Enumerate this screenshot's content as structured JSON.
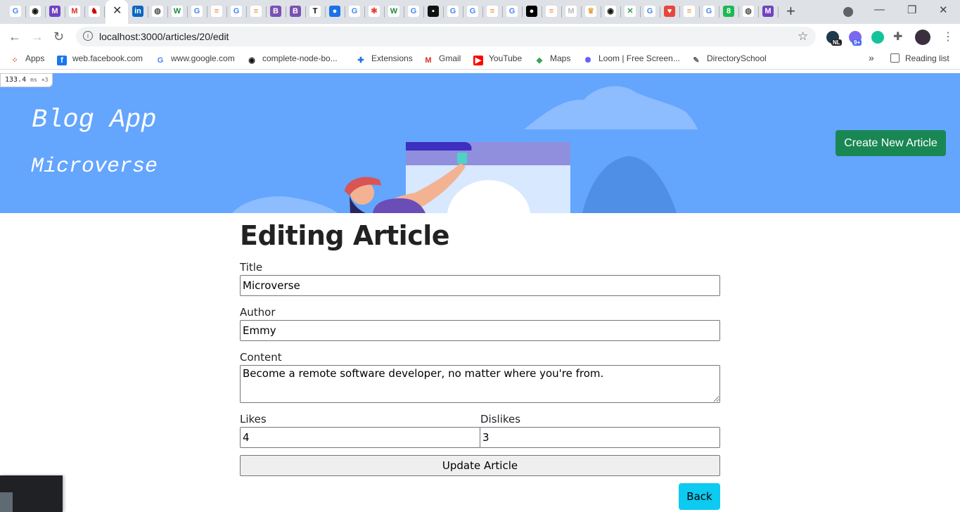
{
  "browser": {
    "tab_icons": [
      {
        "icon": "google-g-icon",
        "color": "#ffffff",
        "glyph": "G",
        "fg": "#4285f4"
      },
      {
        "icon": "github-icon",
        "color": "#ffffff",
        "glyph": "◉",
        "fg": "#111111"
      },
      {
        "icon": "microverse-icon",
        "color": "#6f42c1",
        "glyph": "M",
        "fg": "#ffffff"
      },
      {
        "icon": "gmail-icon",
        "color": "#ffffff",
        "glyph": "M",
        "fg": "#d93025"
      },
      {
        "icon": "dragon-icon",
        "color": "#ffffff",
        "glyph": "♞",
        "fg": "#d00000"
      },
      {
        "icon": "linkedin-icon",
        "color": "#0a66c2",
        "glyph": "in",
        "fg": "#ffffff"
      },
      {
        "icon": "globe-icon",
        "color": "#ffffff",
        "glyph": "◍",
        "fg": "#555555"
      },
      {
        "icon": "w-icon",
        "color": "#ffffff",
        "glyph": "W",
        "fg": "#1b8a3a"
      },
      {
        "icon": "google-g-icon",
        "color": "#ffffff",
        "glyph": "G",
        "fg": "#4285f4"
      },
      {
        "icon": "stackoverflow-icon",
        "color": "#ffffff",
        "glyph": "≡",
        "fg": "#f48024"
      },
      {
        "icon": "google-g-icon",
        "color": "#ffffff",
        "glyph": "G",
        "fg": "#4285f4"
      },
      {
        "icon": "stackoverflow-icon",
        "color": "#ffffff",
        "glyph": "≡",
        "fg": "#f48024"
      },
      {
        "icon": "bootstrap-icon",
        "color": "#7952b3",
        "glyph": "B",
        "fg": "#ffffff"
      },
      {
        "icon": "bootstrap-icon",
        "color": "#7952b3",
        "glyph": "B",
        "fg": "#ffffff"
      },
      {
        "icon": "nyt-icon",
        "color": "#ffffff",
        "glyph": "T",
        "fg": "#000000"
      },
      {
        "icon": "blue-circle-icon",
        "color": "#1a73e8",
        "glyph": "●",
        "fg": "#ffffff"
      },
      {
        "icon": "google-g-icon",
        "color": "#ffffff",
        "glyph": "G",
        "fg": "#4285f4"
      },
      {
        "icon": "asterisk-icon",
        "color": "#ffffff",
        "glyph": "✱",
        "fg": "#e8453c"
      },
      {
        "icon": "w-icon",
        "color": "#ffffff",
        "glyph": "W",
        "fg": "#1b8a3a"
      },
      {
        "icon": "google-g-icon",
        "color": "#ffffff",
        "glyph": "G",
        "fg": "#4285f4"
      },
      {
        "icon": "dark-square-icon",
        "color": "#111111",
        "glyph": "▪",
        "fg": "#ffffff"
      },
      {
        "icon": "google-g-icon",
        "color": "#ffffff",
        "glyph": "G",
        "fg": "#4285f4"
      },
      {
        "icon": "google-g-icon",
        "color": "#ffffff",
        "glyph": "G",
        "fg": "#4285f4"
      },
      {
        "icon": "stackoverflow-icon",
        "color": "#ffffff",
        "glyph": "≡",
        "fg": "#f48024"
      },
      {
        "icon": "google-g-icon",
        "color": "#ffffff",
        "glyph": "G",
        "fg": "#4285f4"
      },
      {
        "icon": "medium-icon",
        "color": "#000000",
        "glyph": "●",
        "fg": "#ffffff"
      },
      {
        "icon": "stackoverflow-icon",
        "color": "#ffffff",
        "glyph": "≡",
        "fg": "#f48024"
      },
      {
        "icon": "microverse-icon",
        "color": "#ffffff",
        "glyph": "M",
        "fg": "#bbbbbb"
      },
      {
        "icon": "crown-icon",
        "color": "#ffffff",
        "glyph": "♛",
        "fg": "#e8a33c"
      },
      {
        "icon": "github-icon",
        "color": "#ffffff",
        "glyph": "◉",
        "fg": "#111111"
      },
      {
        "icon": "leaf-icon",
        "color": "#ffffff",
        "glyph": "✕",
        "fg": "#2e9b4a"
      },
      {
        "icon": "google-g-icon",
        "color": "#ffffff",
        "glyph": "G",
        "fg": "#4285f4"
      },
      {
        "icon": "shield-icon",
        "color": "#e8453c",
        "glyph": "♥",
        "fg": "#ffffff"
      },
      {
        "icon": "stackoverflow-icon",
        "color": "#ffffff",
        "glyph": "≡",
        "fg": "#f48024"
      },
      {
        "icon": "google-g-icon",
        "color": "#ffffff",
        "glyph": "G",
        "fg": "#4285f4"
      },
      {
        "icon": "green-circle-icon",
        "color": "#1db954",
        "glyph": "8",
        "fg": "#ffffff"
      },
      {
        "icon": "globe-icon",
        "color": "#ffffff",
        "glyph": "◍",
        "fg": "#555555"
      },
      {
        "icon": "microverse-icon",
        "color": "#6f42c1",
        "glyph": "M",
        "fg": "#ffffff"
      }
    ],
    "url": "localhost:3000/articles/20/edit",
    "extension_badges": {
      "nl": "NL",
      "count": "9+"
    },
    "bookmarks": [
      {
        "label": "Apps",
        "icon": "apps-grid-icon",
        "color": "#ffffff",
        "glyph": "⁘",
        "fg": "#ea4335"
      },
      {
        "label": "web.facebook.com",
        "icon": "facebook-icon",
        "color": "#1877f2",
        "glyph": "f",
        "fg": "#ffffff"
      },
      {
        "label": "www.google.com",
        "icon": "google-g-icon",
        "color": "#ffffff",
        "glyph": "G",
        "fg": "#4285f4"
      },
      {
        "label": "complete-node-bo...",
        "icon": "github-icon",
        "color": "#ffffff",
        "glyph": "◉",
        "fg": "#111111"
      },
      {
        "label": "Extensions",
        "icon": "puzzle-icon",
        "color": "#ffffff",
        "glyph": "✚",
        "fg": "#1a73e8"
      },
      {
        "label": "Gmail",
        "icon": "gmail-icon",
        "color": "#ffffff",
        "glyph": "M",
        "fg": "#d93025"
      },
      {
        "label": "YouTube",
        "icon": "youtube-icon",
        "color": "#ff0000",
        "glyph": "▶",
        "fg": "#ffffff"
      },
      {
        "label": "Maps",
        "icon": "maps-icon",
        "color": "#ffffff",
        "glyph": "◆",
        "fg": "#34a853"
      },
      {
        "label": "Loom | Free Screen...",
        "icon": "loom-icon",
        "color": "#ffffff",
        "glyph": "✺",
        "fg": "#625df5"
      },
      {
        "label": "DirectorySchool",
        "icon": "pencil-icon",
        "color": "#ffffff",
        "glyph": "✎",
        "fg": "#555555"
      }
    ],
    "more_bookmarks": "»",
    "reading_list": "Reading list"
  },
  "perf_overlay": {
    "value": "133.4",
    "unit": "ms",
    "multiplier": "×3"
  },
  "hero": {
    "title": "Blog App",
    "subtitle": "Microverse",
    "create_button": "Create New Article",
    "bg_color": "#64a5fe",
    "button_color": "#198754"
  },
  "form": {
    "heading": "Editing Article",
    "title_label": "Title",
    "title_value": "Microverse",
    "author_label": "Author",
    "author_value": "Emmy",
    "content_label": "Content",
    "content_value": "Become a remote software developer, no matter where you're from.",
    "likes_label": "Likes",
    "likes_value": "4",
    "dislikes_label": "Dislikes",
    "dislikes_value": "3",
    "submit_label": "Update Article",
    "back_label": "Back"
  }
}
